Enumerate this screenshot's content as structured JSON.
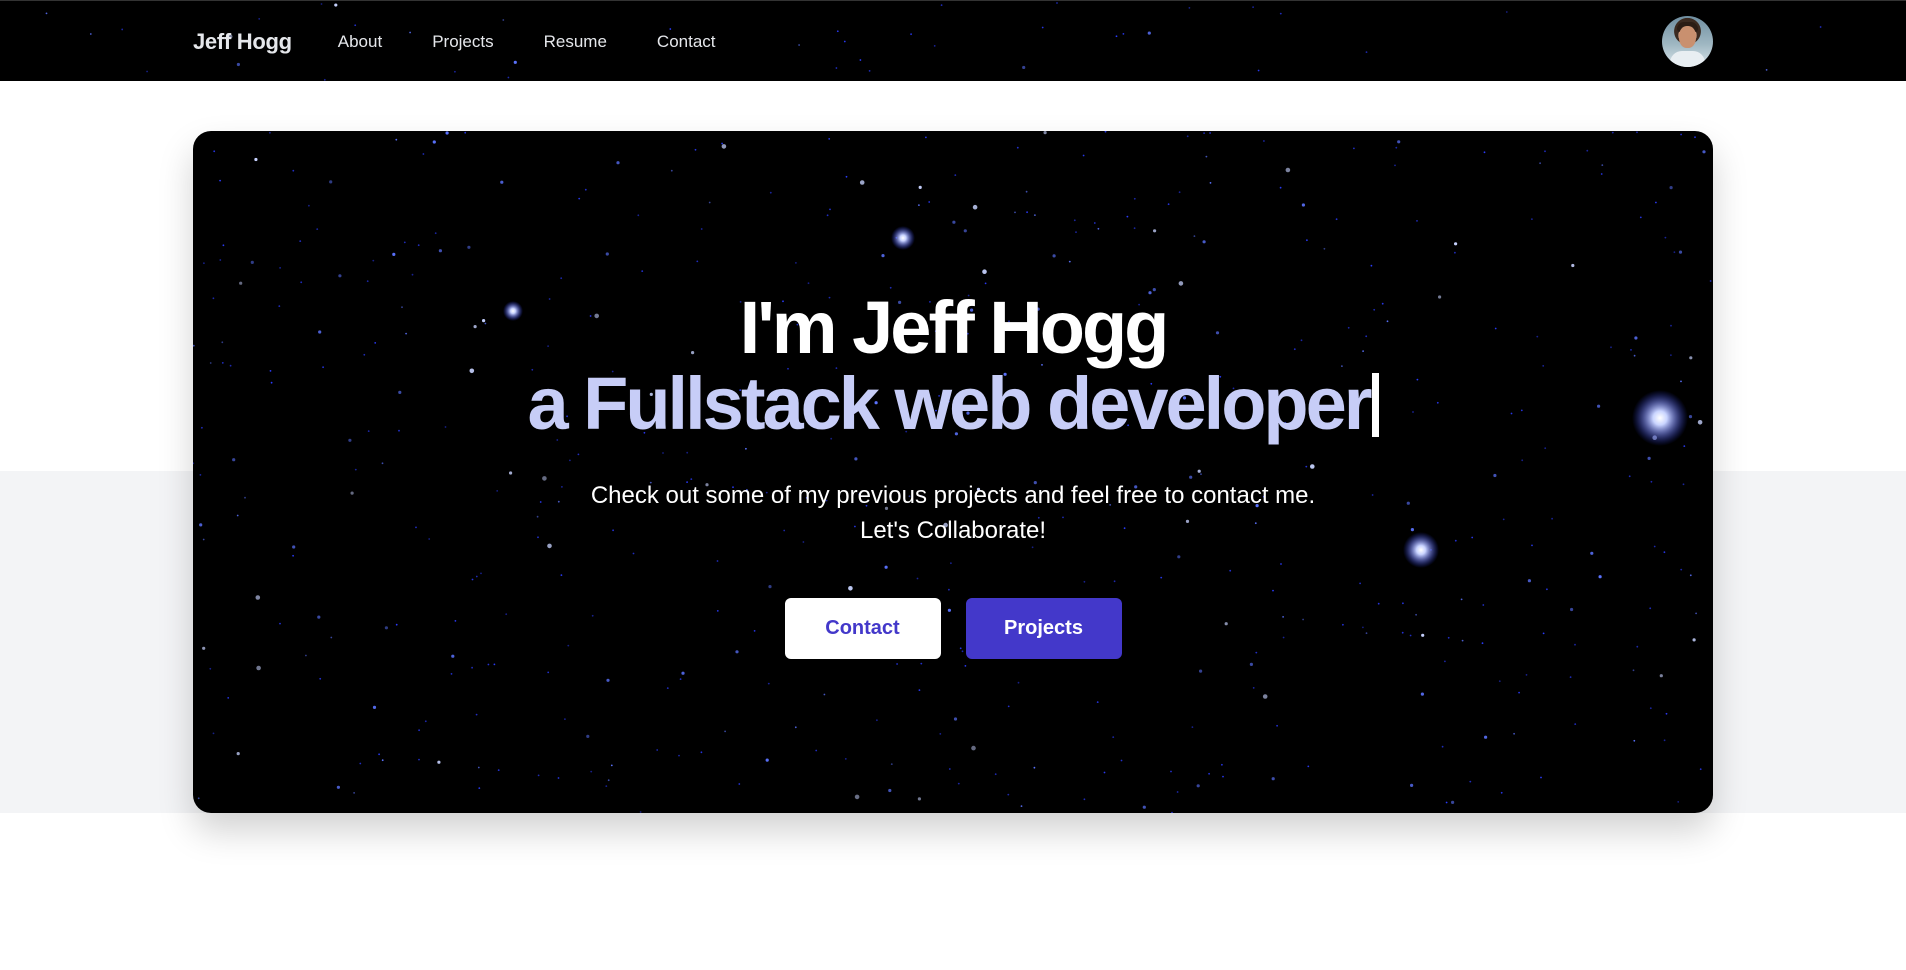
{
  "nav": {
    "brand": "Jeff Hogg",
    "links": [
      {
        "label": "About"
      },
      {
        "label": "Projects"
      },
      {
        "label": "Resume"
      },
      {
        "label": "Contact"
      }
    ],
    "avatar_icon": "profile-avatar"
  },
  "hero": {
    "headline_line1": "I'm Jeff Hogg",
    "headline_line2": "a Fullstack web developer",
    "subtitle_line1": "Check out some of my previous projects and feel free to contact me.",
    "subtitle_line2": "Let's Collaborate!",
    "contact_button": "Contact",
    "projects_button": "Projects"
  },
  "colors": {
    "background": "#000000",
    "accent": "#4338ca",
    "headline_accent": "#c7cdf7",
    "page_gray": "#f3f4f6"
  }
}
